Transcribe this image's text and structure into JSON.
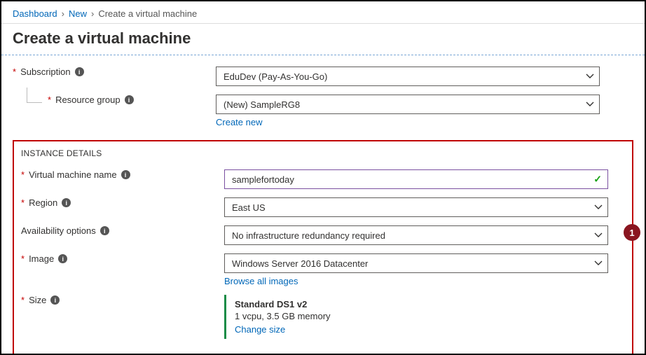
{
  "breadcrumb": {
    "items": [
      {
        "label": "Dashboard",
        "kind": "link"
      },
      {
        "label": "New",
        "kind": "link"
      },
      {
        "label": "Create a virtual machine",
        "kind": "current"
      }
    ]
  },
  "page_title": "Create a virtual machine",
  "project": {
    "subscription": {
      "label": "Subscription",
      "value": "EduDev (Pay-As-You-Go)"
    },
    "resource_group": {
      "label": "Resource group",
      "value": "(New) SampleRG8",
      "create_new": "Create new"
    }
  },
  "instance": {
    "heading": "INSTANCE DETAILS",
    "vm_name": {
      "label": "Virtual machine name",
      "value": "samplefortoday"
    },
    "region": {
      "label": "Region",
      "value": "East US"
    },
    "availability": {
      "label": "Availability options",
      "value": "No infrastructure redundancy required"
    },
    "image": {
      "label": "Image",
      "value": "Windows Server 2016 Datacenter",
      "browse_link": "Browse all images"
    },
    "size": {
      "label": "Size",
      "name": "Standard DS1 v2",
      "desc": "1 vcpu, 3.5 GB memory",
      "change_link": "Change size"
    }
  },
  "callout": {
    "number": "1"
  }
}
